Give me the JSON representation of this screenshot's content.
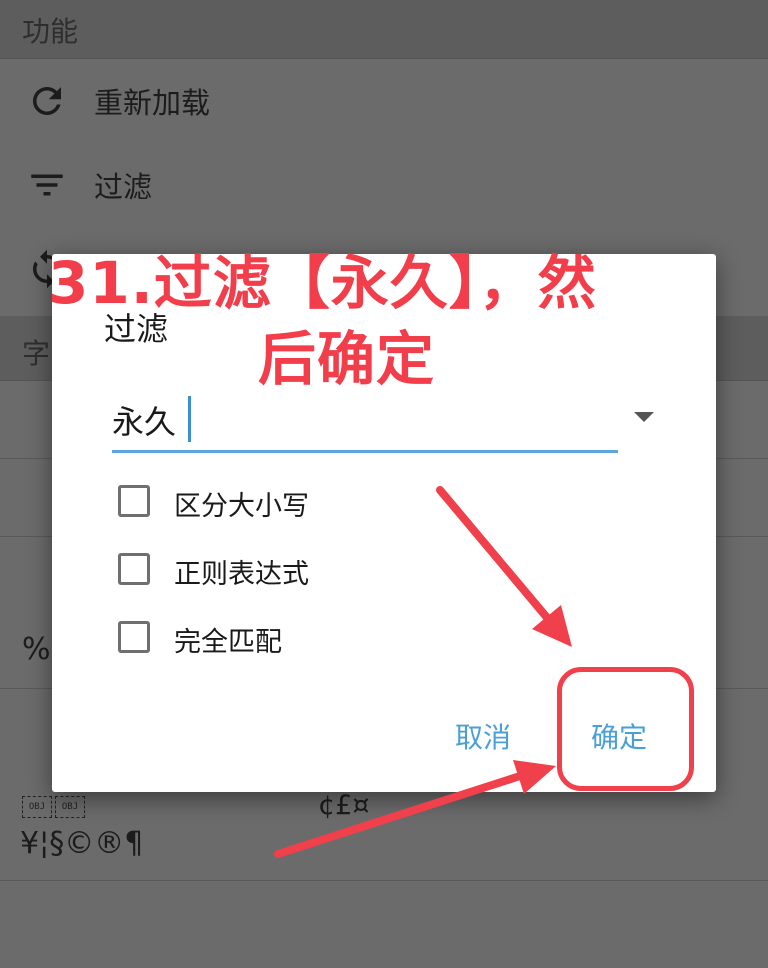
{
  "background": {
    "section_function": "功能",
    "menu_items": [
      {
        "label": "重新加载",
        "icon": "reload-icon"
      },
      {
        "label": "过滤",
        "icon": "filter-icon"
      },
      {
        "label": "",
        "icon": "sync-icon"
      }
    ],
    "section_char": "字",
    "percent_text": "%",
    "currency_symbols": "¢£¤",
    "symbols_row": "¥¦§©®¶",
    "obj_label": "OBJ"
  },
  "dialog": {
    "title": "过滤",
    "input_value": "永久",
    "checkboxes": [
      {
        "label": "区分大小写",
        "checked": false
      },
      {
        "label": "正则表达式",
        "checked": false
      },
      {
        "label": "完全匹配",
        "checked": false
      }
    ],
    "cancel_label": "取消",
    "ok_label": "确定"
  },
  "annotation": {
    "line1": "31.过滤【永久】，然",
    "line2": "后确定",
    "color": "#f23d4a"
  },
  "colors": {
    "accent": "#4a9fd6",
    "underline": "#5aa8dd",
    "overlay_bg": "#6b6b6b"
  }
}
